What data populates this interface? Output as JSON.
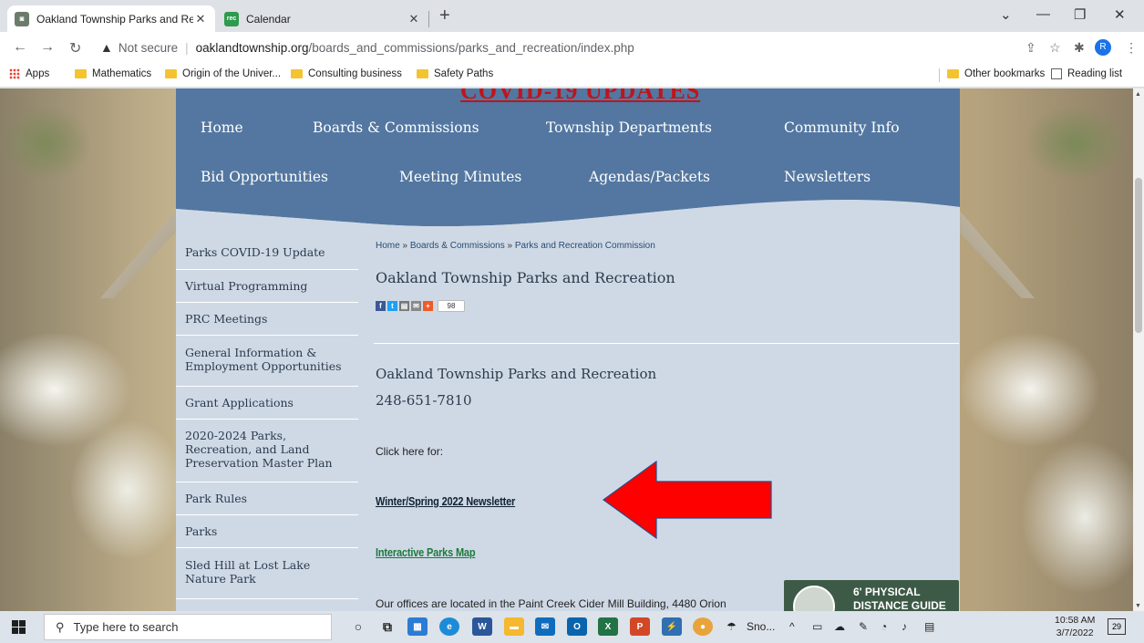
{
  "browser": {
    "tabs": [
      {
        "title": "Oakland Township Parks and Rec",
        "active": true
      },
      {
        "title": "Calendar",
        "active": false
      }
    ],
    "new_tab": "+",
    "address": {
      "security": "Not secure",
      "host": "oaklandtownship.org",
      "path": "/boards_and_commissions/parks_and_recreation/index.php"
    },
    "profile_initial": "R",
    "bookmarks": [
      {
        "label": "Apps",
        "type": "apps"
      },
      {
        "label": "Mathematics",
        "type": "folder"
      },
      {
        "label": "Origin of the Univer...",
        "type": "folder"
      },
      {
        "label": "Consulting business",
        "type": "folder"
      },
      {
        "label": "Safety Paths",
        "type": "folder"
      }
    ],
    "other_bookmarks": "Other bookmarks",
    "reading_list": "Reading list"
  },
  "site": {
    "banner": "COVID-19 UPDATES",
    "nav": {
      "row1": [
        "Home",
        "Boards & Commissions",
        "Township Departments",
        "Community Info"
      ],
      "row2": [
        "Bid Opportunities",
        "Meeting Minutes",
        "Agendas/Packets",
        "Newsletters"
      ]
    },
    "sidebar": [
      "Parks COVID-19 Update",
      "Virtual Programming",
      "PRC Meetings",
      "General Information & Employment Opportunities",
      "Grant Applications",
      "2020-2024 Parks, Recreation, and Land Preservation Master Plan",
      "Park Rules",
      "Parks",
      "Sled Hill at Lost Lake Nature Park"
    ],
    "breadcrumb": [
      "Home",
      "Boards & Commissions",
      "Parks and Recreation Commission"
    ],
    "breadcrumb_sep": "»",
    "page_title": "Oakland Township Parks and Recreation",
    "share_count": "98",
    "org_name": "Oakland Township Parks and Recreation",
    "phone": "248-651-7810",
    "click_here": "Click here for:",
    "newsletter_link": "Winter/Spring 2022 Newsletter",
    "map_link": "Interactive Parks Map",
    "offices_text": "Our offices are located in the Paint Creek Cider Mill Building, 4480 Orion",
    "guide_line1": "6' PHYSICAL",
    "guide_line2": "DISTANCE GUIDE"
  },
  "taskbar": {
    "search_placeholder": "Type here to search",
    "weather": "Sno...",
    "time": "10:58 AM",
    "date": "3/7/2022",
    "notifications": "29"
  },
  "colors": {
    "nav_bg": "#5377a0",
    "content_bg": "#cfd9e6",
    "banner_red": "#c0141a",
    "arrow_red": "#ff0000",
    "map_link_green": "#1d7a3a"
  }
}
